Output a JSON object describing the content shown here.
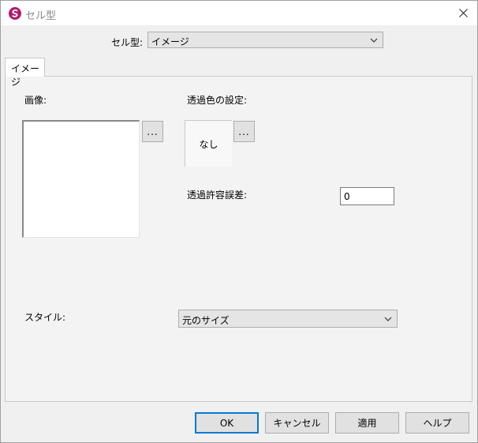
{
  "window": {
    "title": "セル型"
  },
  "cell_type": {
    "label": "セル型:",
    "value": "イメージ"
  },
  "tab": {
    "label": "イメージ"
  },
  "image": {
    "label": "画像:",
    "browse_label": "..."
  },
  "transparency": {
    "label": "透過色の設定:",
    "color_value": "なし",
    "browse_label": "...",
    "tolerance_label": "透過許容誤差:",
    "tolerance_value": "0"
  },
  "style": {
    "label": "スタイル:",
    "value": "元のサイズ"
  },
  "buttons": {
    "ok": "OK",
    "cancel": "キャンセル",
    "apply": "適用",
    "help": "ヘルプ"
  },
  "colors": {
    "accent": "#0078d7",
    "app_icon": "#b4196f"
  }
}
